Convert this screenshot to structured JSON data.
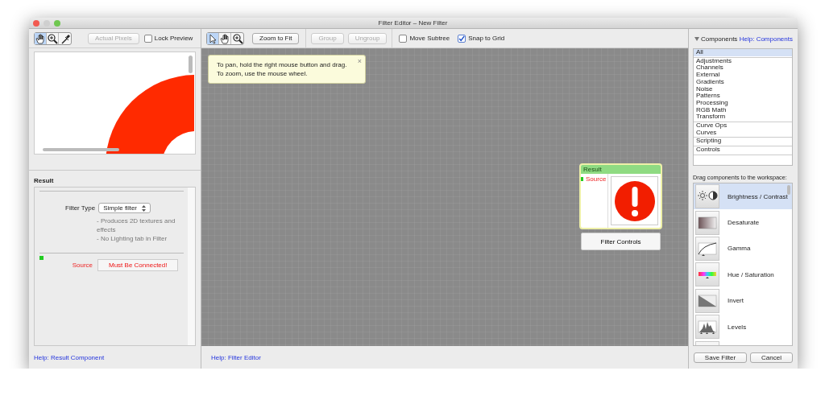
{
  "window": {
    "title": "Filter Editor – New Filter"
  },
  "preview_panel": {
    "tools": [
      {
        "kind": "hand",
        "selected": true
      },
      {
        "kind": "zoom",
        "selected": false
      },
      {
        "kind": "eyedropper",
        "selected": false
      }
    ],
    "actual_pixels_button": {
      "label": "Actual Pixels",
      "disabled": true
    },
    "lock_preview": {
      "label": "Lock Preview",
      "checked": false
    }
  },
  "inspector": {
    "title": "Result",
    "filter_type_label": "Filter Type",
    "filter_type_value": "Simple filter",
    "notes": [
      "- Produces 2D textures and effects",
      "- No Lighting tab in Filter"
    ],
    "source_label": "Source",
    "source_value": "Must Be Connected!",
    "help_link": "Help: Result Component"
  },
  "canvas_toolbar": {
    "tools": [
      {
        "kind": "pointer",
        "selected": true
      },
      {
        "kind": "hand",
        "selected": false
      },
      {
        "kind": "zoom",
        "selected": false
      }
    ],
    "buttons": [
      {
        "label": "Zoom to Fit",
        "disabled": false
      },
      {
        "label": "Group",
        "disabled": true
      },
      {
        "label": "Ungroup",
        "disabled": true
      }
    ],
    "checkboxes": [
      {
        "label": "Move Subtree",
        "checked": false
      },
      {
        "label": "Snap to Grid",
        "checked": true
      }
    ]
  },
  "tip": {
    "lines": [
      "To pan, hold the right mouse button and drag.",
      "To zoom, use the mouse wheel."
    ],
    "close": "×"
  },
  "node": {
    "title": "Result",
    "input": "Source",
    "controls_button": "Filter Controls"
  },
  "canvas_help_link": "Help: Filter Editor",
  "components": {
    "header": "Components",
    "expanded": true,
    "help_link": "Help: Components",
    "groups": [
      [
        {
          "label": "All",
          "selected": true
        }
      ],
      [
        {
          "label": "Adjustments",
          "selected": false
        },
        {
          "label": "Channels",
          "selected": false
        },
        {
          "label": "External",
          "selected": false
        },
        {
          "label": "Gradients",
          "selected": false
        },
        {
          "label": "Noise",
          "selected": false
        },
        {
          "label": "Patterns",
          "selected": false
        },
        {
          "label": "Processing",
          "selected": false
        },
        {
          "label": "RGB Math",
          "selected": false
        },
        {
          "label": "Transform",
          "selected": false
        }
      ],
      [
        {
          "label": "Curve Ops",
          "selected": false
        },
        {
          "label": "Curves",
          "selected": false
        }
      ],
      [
        {
          "label": "Scripting",
          "selected": false
        }
      ],
      [
        {
          "label": "Controls",
          "selected": false
        }
      ]
    ],
    "drag_hint": "Drag components to the workspace:",
    "items": [
      {
        "kind": "brightness",
        "label": "Brightness / Contrast",
        "selected": true
      },
      {
        "kind": "desaturate",
        "label": "Desaturate",
        "selected": false
      },
      {
        "kind": "gamma",
        "label": "Gamma",
        "selected": false
      },
      {
        "kind": "hue",
        "label": "Hue / Saturation",
        "selected": false
      },
      {
        "kind": "invert",
        "label": "Invert",
        "selected": false
      },
      {
        "kind": "levels",
        "label": "Levels",
        "selected": false
      }
    ]
  },
  "buttons": [
    {
      "label": "Save Filter"
    },
    {
      "label": "Cancel"
    }
  ]
}
